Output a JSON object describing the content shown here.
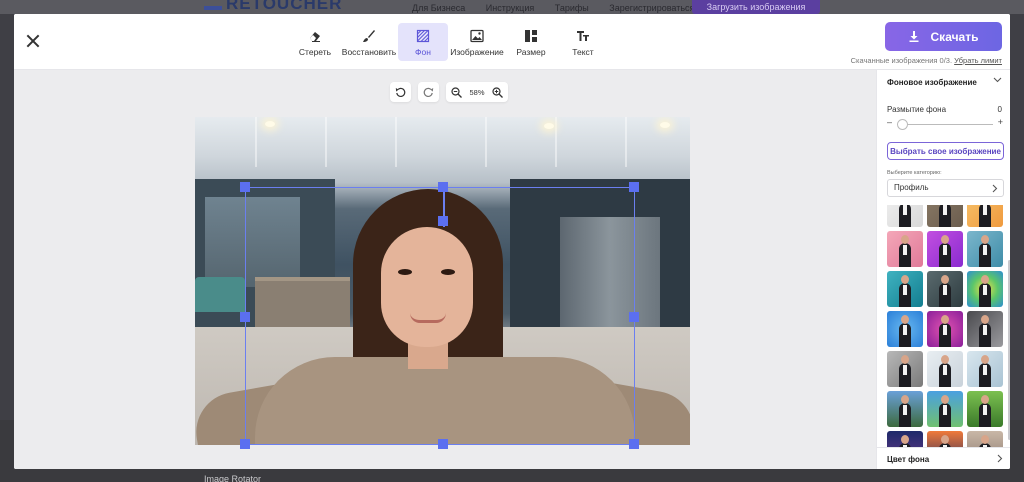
{
  "site": {
    "logo_text": "RETOUCHER",
    "nav": [
      "Для Бизнеса",
      "Инструкция",
      "Тарифы",
      "Зарегистрироваться"
    ],
    "upload_label": "Загрузить изображения",
    "footer_text": "Image Rotator"
  },
  "toolbar": {
    "tools": [
      {
        "label": "Стереть",
        "icon": "eraser-icon"
      },
      {
        "label": "Восстановить",
        "icon": "brush-icon"
      },
      {
        "label": "Фон",
        "icon": "background-icon",
        "active": true
      },
      {
        "label": "Изображение",
        "icon": "image-icon"
      },
      {
        "label": "Размер",
        "icon": "layout-icon"
      },
      {
        "label": "Текст",
        "icon": "text-icon"
      }
    ],
    "download_label": "Скачать",
    "limit_text": "Скачанные изображения 0/3.",
    "limit_link": "Убрать лимит"
  },
  "canvas": {
    "zoom": "58%",
    "accent": "#5b6ff0"
  },
  "sidebar": {
    "section_title": "Фоновое изображение",
    "blur_label": "Размытие фона",
    "blur_value": "0",
    "minus": "–",
    "plus": "+",
    "own_image_label": "Выбрать свое изображение",
    "category_label": "Выберите категорию:",
    "category_value": "Профиль",
    "color_section": "Цвет фона",
    "accent": "#7b65d8",
    "thumbnails": [
      {
        "bg": "linear-gradient(135deg,#f0f0f0,#d8d8d8)"
      },
      {
        "bg": "linear-gradient(135deg,#8a7a66,#6b5d4e)"
      },
      {
        "bg": "linear-gradient(135deg,#f6c26b,#f09a3e)"
      },
      {
        "bg": "linear-gradient(135deg,#f4a7b8,#e07a99)"
      },
      {
        "bg": "linear-gradient(135deg,#c24fe0,#8a2bd0)"
      },
      {
        "bg": "linear-gradient(135deg,#7bb6cc,#3f8da8)"
      },
      {
        "bg": "linear-gradient(135deg,#3fb2c0,#137e90)"
      },
      {
        "bg": "linear-gradient(135deg,#5a6a6e,#2e3c40)"
      },
      {
        "bg": "radial-gradient(circle,#f4e24a,#5bc66a,#2e8fd0)"
      },
      {
        "bg": "radial-gradient(circle,#67b8f0,#2b7fd8)"
      },
      {
        "bg": "radial-gradient(circle,#e052b0,#8a1f9a)"
      },
      {
        "bg": "linear-gradient(135deg,#4a4a4e,#9a9a9e)"
      },
      {
        "bg": "linear-gradient(135deg,#b8b8b8,#7a7a7a)"
      },
      {
        "bg": "linear-gradient(135deg,#e8eef2,#c9d2da)"
      },
      {
        "bg": "linear-gradient(135deg,#d8e6ee,#a9c3d3)"
      },
      {
        "bg": "linear-gradient(180deg,#6aa0d8,#3d6a3e)"
      },
      {
        "bg": "linear-gradient(180deg,#4aa0e0,#70c070)"
      },
      {
        "bg": "linear-gradient(180deg,#7cc050,#3a7a2a)"
      },
      {
        "bg": "linear-gradient(180deg,#1f2a6a,#6a3a8a)"
      },
      {
        "bg": "linear-gradient(180deg,#f07a3a,#2a2a5a)"
      },
      {
        "bg": "linear-gradient(180deg,#c9b7a7,#8a7a6e)"
      }
    ]
  }
}
